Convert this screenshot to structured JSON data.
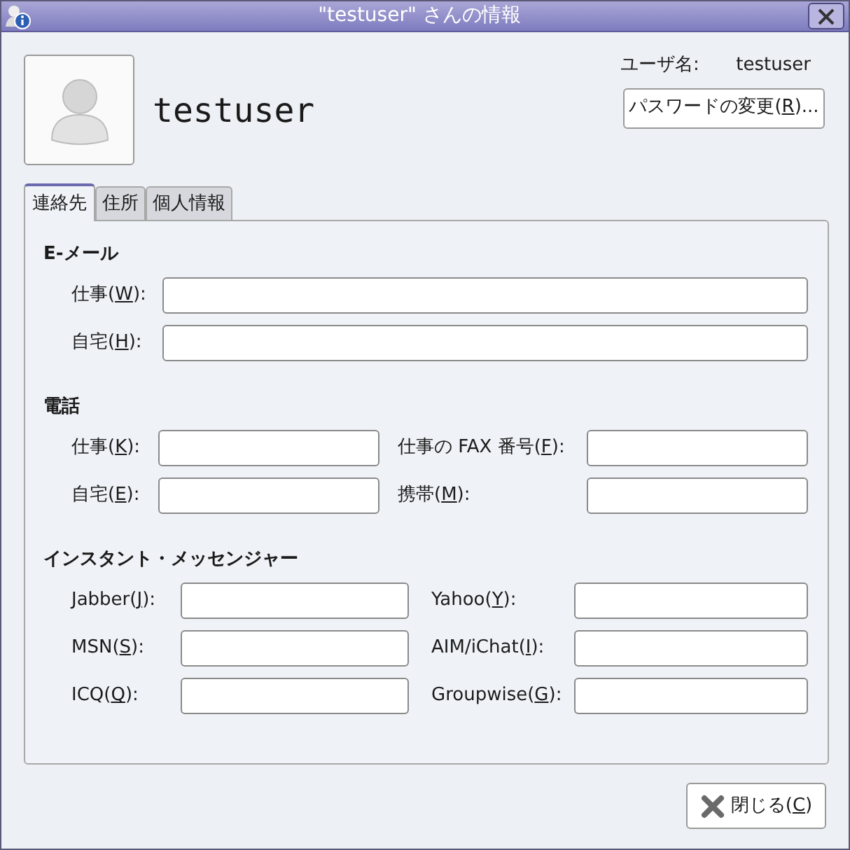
{
  "window": {
    "title": "\"testuser\" さんの情報"
  },
  "user": {
    "display_name": "testuser",
    "username_label": "ユーザ名:",
    "username": "testuser"
  },
  "password_button": {
    "pre": "パスワードの変更(",
    "key": "R",
    "post": ")..."
  },
  "tabs": [
    {
      "label": "連絡先",
      "selected": true
    },
    {
      "label": "住所",
      "selected": false
    },
    {
      "label": "個人情報",
      "selected": false
    }
  ],
  "sections": [
    {
      "heading": "E-メール",
      "kind": "wide",
      "fields": [
        {
          "pre": "仕事(",
          "key": "W",
          "post": "):"
        },
        {
          "pre": "自宅(",
          "key": "H",
          "post": "):"
        }
      ]
    },
    {
      "heading": "電話",
      "kind": "phone",
      "fields": [
        {
          "pre": "仕事(",
          "key": "K",
          "post": "):"
        },
        {
          "pre": "仕事の FAX 番号(",
          "key": "F",
          "post": "):"
        },
        {
          "pre": "自宅(",
          "key": "E",
          "post": "):"
        },
        {
          "pre": "携帯(",
          "key": "M",
          "post": "):"
        }
      ]
    },
    {
      "heading": "インスタント・メッセンジャー",
      "kind": "im",
      "fields": [
        {
          "pre": "Jabber(",
          "key": "J",
          "post": "):"
        },
        {
          "pre": "Yahoo(",
          "key": "Y",
          "post": "):"
        },
        {
          "pre": "MSN(",
          "key": "S",
          "post": "):"
        },
        {
          "pre": "AIM/iChat(",
          "key": "I",
          "post": "):"
        },
        {
          "pre": "ICQ(",
          "key": "Q",
          "post": "):"
        },
        {
          "pre": "Groupwise(",
          "key": "G",
          "post": "):"
        }
      ]
    }
  ],
  "close_button": {
    "pre": "閉じる(",
    "key": "C",
    "post": ")"
  }
}
